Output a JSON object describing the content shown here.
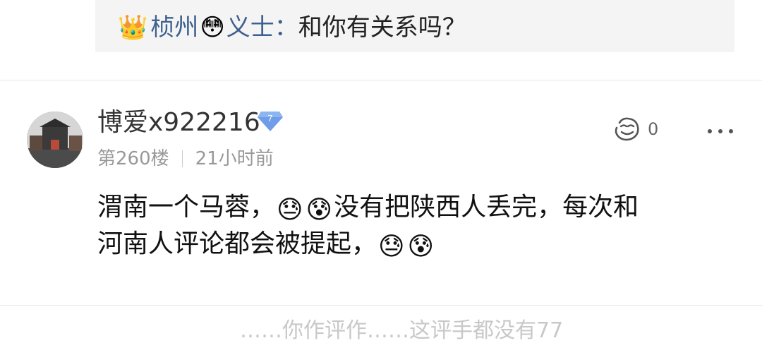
{
  "reply_quote": {
    "crown_icon": "crown-icon",
    "name_part1": "桢州",
    "emoji_mid": "😳",
    "name_part2": "义士",
    "colon": "：",
    "text": "和你有关系吗？"
  },
  "comment": {
    "username": "博爱x922216",
    "level_badge": "7",
    "floor": "第260楼",
    "time": "21小时前",
    "like_count": "0",
    "line1_a": "渭南一个马蓉，",
    "emoji_a": "😓",
    "emoji_b": "😰",
    "line1_b": "没有把陕西人丢完，每次和",
    "line2": "河南人评论都会被提起，",
    "emoji_c": "😓",
    "emoji_d": "😰"
  },
  "bottom_hint": "……你作评作……这评手都没有77"
}
